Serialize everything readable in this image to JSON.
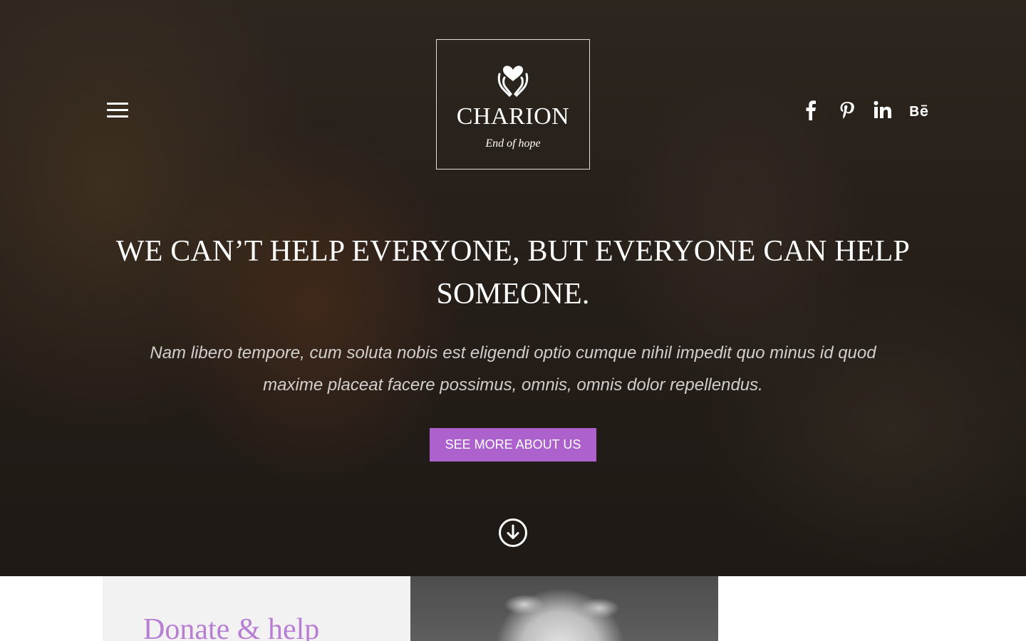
{
  "header": {
    "menu_icon": "hamburger-menu-icon",
    "logo": {
      "icon": "heart-in-hands-icon",
      "name": "CHARION",
      "tagline": "End of hope"
    },
    "social": [
      {
        "name": "facebook-icon",
        "glyph": "f"
      },
      {
        "name": "pinterest-icon",
        "glyph": "P"
      },
      {
        "name": "linkedin-icon",
        "glyph": "in"
      },
      {
        "name": "behance-icon",
        "glyph": "Bē"
      }
    ]
  },
  "hero": {
    "headline_line1": "WE CAN’T HELP EVERYONE, BUT EVERYONE CAN HELP",
    "headline_line2": "SOMEONE.",
    "subtext_line1": "Nam libero tempore, cum soluta nobis est eligendi optio cumque nihil impedit quo minus id quod",
    "subtext_line2": "maxime placeat facere possimus, omnis, omnis dolor repellendus.",
    "cta_label": "SEE MORE ABOUT US",
    "scroll_icon": "arrow-down-circle-icon"
  },
  "sections": {
    "donate_title": "Donate & help"
  },
  "colors": {
    "accent": "#ac61cc",
    "donate_title": "#b77ed3",
    "panel_bg": "#f2f2f2"
  }
}
